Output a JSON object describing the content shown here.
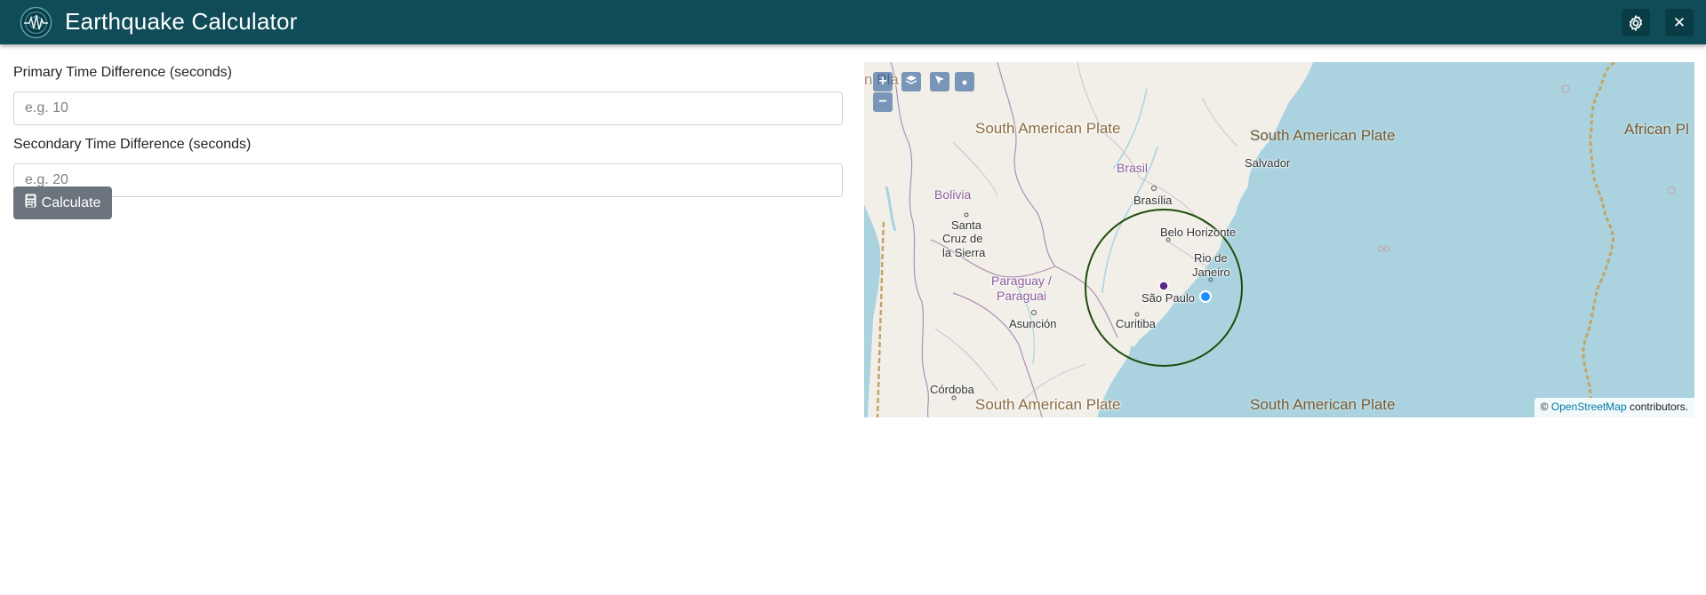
{
  "header": {
    "title": "Earthquake Calculator",
    "settings_icon": "gear-icon",
    "close_icon": "close-icon",
    "close_glyph": "✕"
  },
  "form": {
    "primary_label": "Primary Time Difference (seconds)",
    "primary_placeholder": "e.g. 10",
    "primary_value": "",
    "secondary_label": "Secondary Time Difference (seconds)",
    "secondary_placeholder": "e.g. 20",
    "secondary_value": "",
    "calculate_label": "Calculate",
    "calculate_icon": "calculator-icon"
  },
  "map": {
    "controls": {
      "zoom_in": "+",
      "zoom_out": "−",
      "layers_icon": "layers-icon",
      "select_icon": "cursor-arrow-icon",
      "point_icon": "point-icon"
    },
    "plate_labels": [
      "South American Plate",
      "South American Plate",
      "South American Plate",
      "South American Plate",
      "African Pl",
      "n Pla"
    ],
    "country_labels": {
      "brasil": "Brasil",
      "bolivia": "Bolivia",
      "paraguay": "Paraguay /",
      "paraguai": "Paraguai"
    },
    "city_labels": {
      "salvador": "Salvador",
      "brasilia": "Brasília",
      "belo_horizonte": "Belo Horizonte",
      "rio_1": "Rio de",
      "rio_2": "Janeiro",
      "sao_paulo": "São Paulo",
      "curitiba": "Curitiba",
      "santa_1": "Santa",
      "santa_2": "Cruz de",
      "santa_3": "la Sierra",
      "asuncion": "Asunción",
      "cordoba": "Córdoba"
    },
    "attribution_prefix": "©",
    "attribution_link": "OpenStreetMap",
    "attribution_suffix": "contributors.",
    "colors": {
      "land": "#f2efe9",
      "water": "#aad3df",
      "radius_circle": "#1e4d0b",
      "epicenter_marker": "#5b2a86",
      "station_marker": "#1e90ff"
    }
  }
}
